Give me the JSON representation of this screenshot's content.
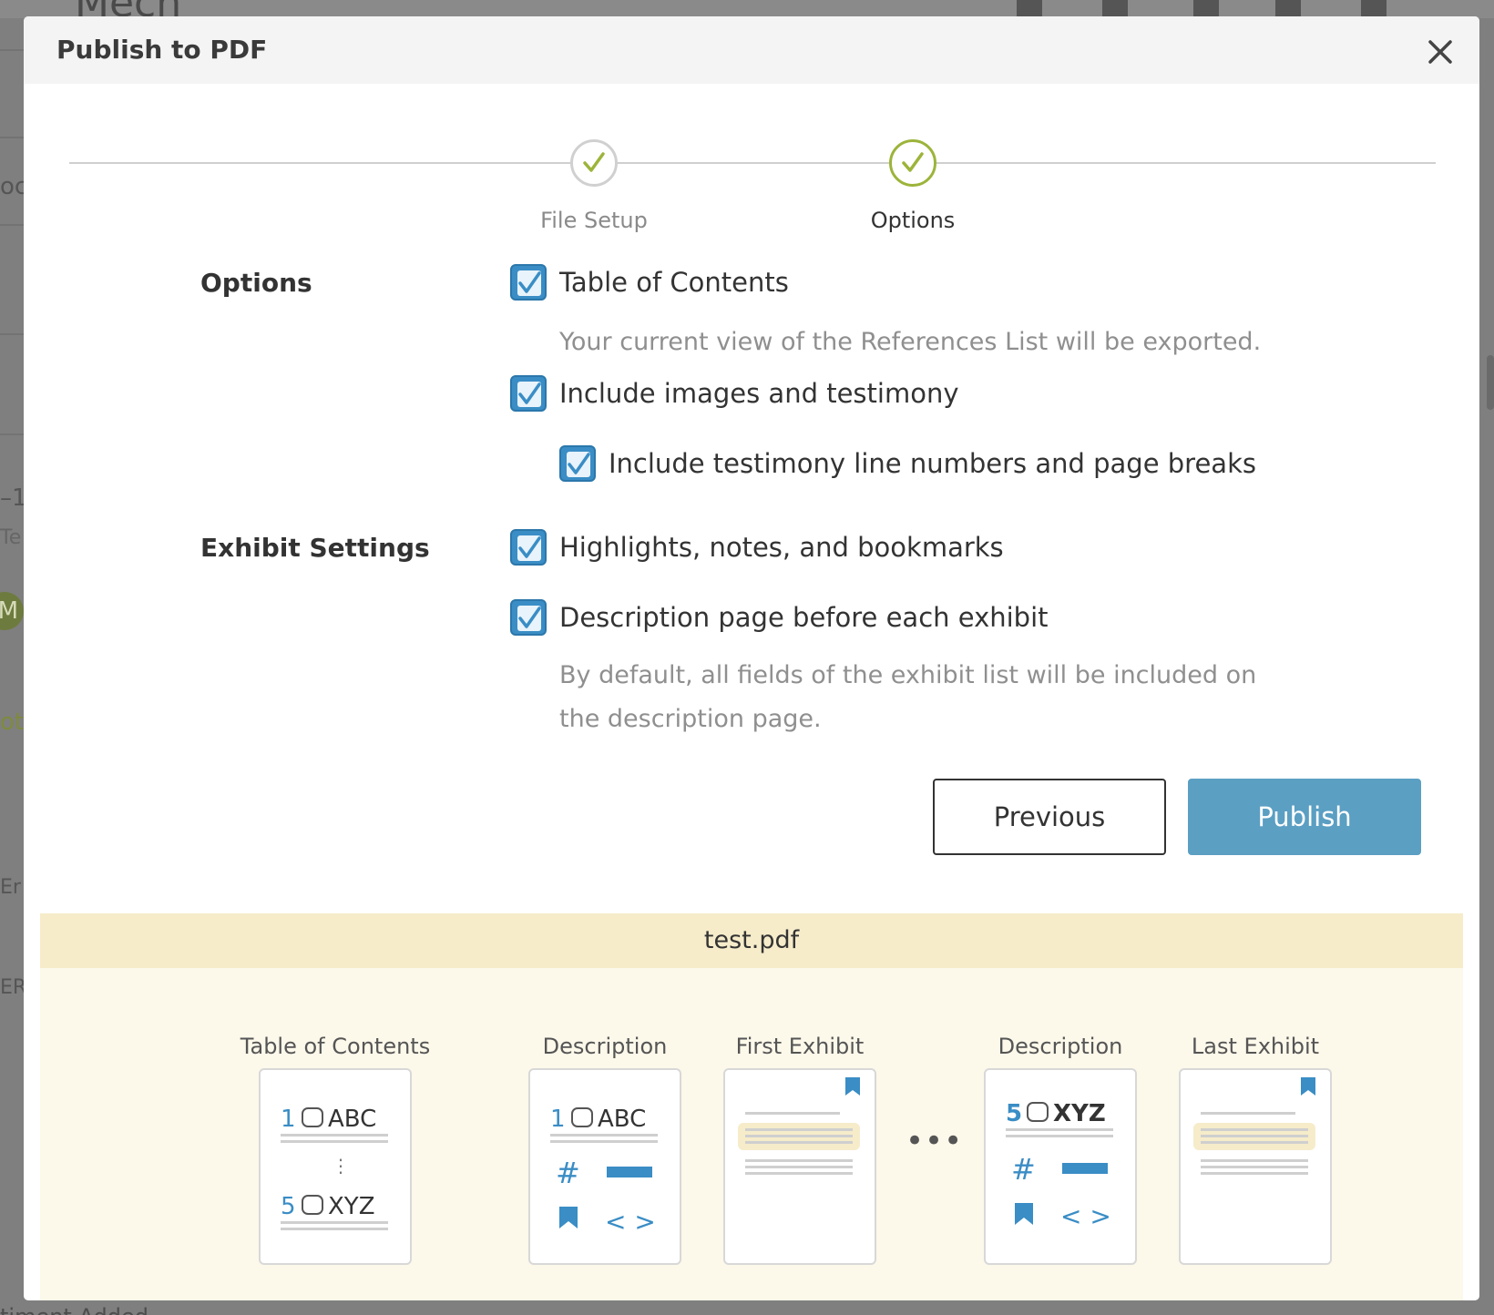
{
  "background": {
    "app_title": "Mech",
    "fragments": [
      "oc",
      "–1",
      "Te",
      "M",
      "oti",
      "Er",
      "ER"
    ],
    "bottom_text": "timent Added"
  },
  "modal": {
    "title": "Publish to PDF",
    "close_icon": "close-icon"
  },
  "stepper": {
    "steps": [
      {
        "label": "File Setup",
        "state": "completed"
      },
      {
        "label": "Options",
        "state": "active"
      }
    ],
    "colors": {
      "inactive": "#d0d0d0",
      "active": "#9cb43a"
    }
  },
  "sections": {
    "options": {
      "heading": "Options",
      "items": [
        {
          "label": "Table of Contents",
          "checked": true,
          "hint": "Your current view of the References List will be exported."
        },
        {
          "label": "Include images and testimony",
          "checked": true
        },
        {
          "label": "Include testimony line numbers and page breaks",
          "checked": true
        }
      ]
    },
    "exhibit": {
      "heading": "Exhibit Settings",
      "items": [
        {
          "label": "Highlights, notes, and bookmarks",
          "checked": true
        },
        {
          "label": "Description page before each exhibit",
          "checked": true,
          "hint": "By default, all fields of the exhibit list will be included on the description page."
        }
      ]
    }
  },
  "buttons": {
    "previous": "Previous",
    "publish": "Publish",
    "publish_color": "#5b9fc3"
  },
  "preview": {
    "filename": "test.pdf",
    "pages": [
      {
        "label": "Table of Contents",
        "lines": [
          {
            "num": "1",
            "text": "ABC"
          },
          {
            "num": "5",
            "text": "XYZ"
          }
        ],
        "separator": "⋮"
      },
      {
        "label": "Description",
        "num": "1",
        "text": "ABC",
        "hash": "#",
        "brackets": "< >"
      },
      {
        "label": "First Exhibit"
      },
      {
        "label": "Description",
        "num": "5",
        "text": "XYZ",
        "hash": "#",
        "brackets": "< >"
      },
      {
        "label": "Last Exhibit"
      }
    ],
    "ellipsis": "•••",
    "colors": {
      "accent": "#3a8dc5",
      "highlight": "#f6ecca"
    }
  }
}
